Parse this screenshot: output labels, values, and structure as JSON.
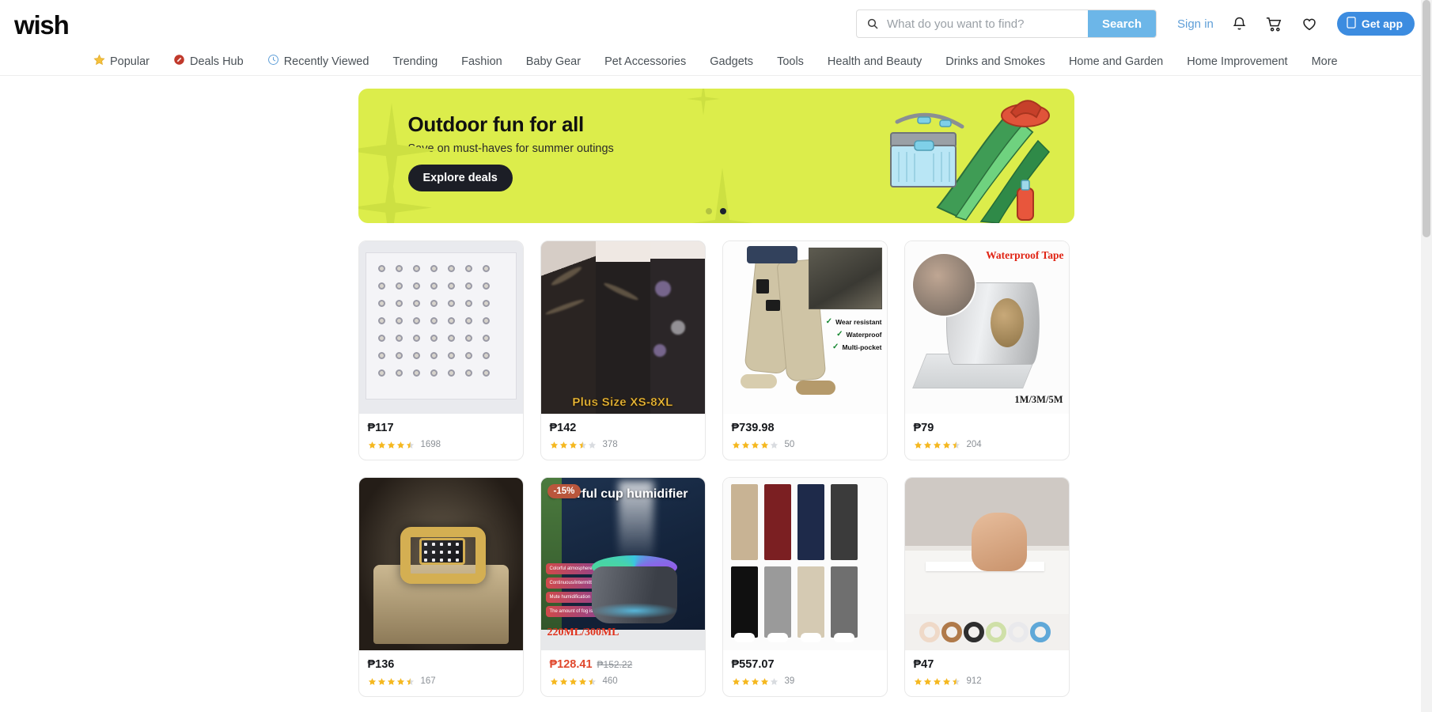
{
  "brand": {
    "logo_text": "wish"
  },
  "search": {
    "placeholder": "What do you want to find?",
    "value": "",
    "button_label": "Search",
    "icon": "search-icon"
  },
  "account": {
    "signin_label": "Sign in",
    "bell_icon": "bell-icon",
    "cart_icon": "cart-icon",
    "wishlist_icon": "heart-icon",
    "getapp_label": "Get app",
    "getapp_icon": "mobile-phone-icon"
  },
  "nav": {
    "items": [
      {
        "label": "Popular",
        "icon": "star-icon"
      },
      {
        "label": "Deals Hub",
        "icon": "tag-icon"
      },
      {
        "label": "Recently Viewed",
        "icon": "clock-icon"
      },
      {
        "label": "Trending",
        "icon": ""
      },
      {
        "label": "Fashion",
        "icon": ""
      },
      {
        "label": "Baby Gear",
        "icon": ""
      },
      {
        "label": "Pet Accessories",
        "icon": ""
      },
      {
        "label": "Gadgets",
        "icon": ""
      },
      {
        "label": "Tools",
        "icon": ""
      },
      {
        "label": "Health and Beauty",
        "icon": ""
      },
      {
        "label": "Drinks and Smokes",
        "icon": ""
      },
      {
        "label": "Home and Garden",
        "icon": ""
      },
      {
        "label": "Home Improvement",
        "icon": ""
      },
      {
        "label": "More",
        "icon": ""
      }
    ]
  },
  "banner": {
    "title": "Outdoor fun for all",
    "subtitle": "Save on must-haves for summer outings",
    "cta_label": "Explore deals",
    "background_color": "#dced4b",
    "cta_background": "#1c1e26",
    "dots": [
      {
        "active": false
      },
      {
        "active": true
      }
    ]
  },
  "products": [
    {
      "name": "stainless-steel-ring-assortment",
      "price": "₱117",
      "old_price": "",
      "rating": 4.5,
      "reviews": "1698",
      "badge": "",
      "image_caption": ""
    },
    {
      "name": "plus-size-marble-print-leggings",
      "price": "₱142",
      "old_price": "",
      "rating": 3.5,
      "reviews": "378",
      "badge": "",
      "image_caption": "Plus Size XS-8XL"
    },
    {
      "name": "tactical-cargo-pants",
      "price": "₱739.98",
      "old_price": "",
      "rating": 4.0,
      "reviews": "50",
      "badge": "",
      "image_caption": "",
      "features": [
        "Wear resistant",
        "Waterproof",
        "Multi-pocket"
      ]
    },
    {
      "name": "butyl-waterproof-tape",
      "price": "₱79",
      "old_price": "",
      "rating": 4.5,
      "reviews": "204",
      "badge": "",
      "image_caption": "Waterproof Tape",
      "image_caption2": "1M/3M/5M"
    },
    {
      "name": "gold-diamond-ring-in-box",
      "price": "₱136",
      "old_price": "",
      "rating": 4.5,
      "reviews": "167",
      "badge": "",
      "image_caption": ""
    },
    {
      "name": "colorful-cup-humidifier",
      "price": "₱128.41",
      "old_price": "₱152.22",
      "rating": 4.5,
      "reviews": "460",
      "badge": "-15%",
      "image_caption": "Colorful cup humidifier",
      "image_caption2": "220ML/300ML",
      "feature_chips": [
        "Colorful atmosphere lights",
        "Continuous/intermittent spray",
        "Mute humidification",
        "The amount of fog is visible"
      ]
    },
    {
      "name": "casual-cargo-joggers",
      "price": "₱557.07",
      "old_price": "",
      "rating": 4.0,
      "reviews": "39",
      "badge": "",
      "image_caption": ""
    },
    {
      "name": "bathtub-caulk-sealing-tape",
      "price": "₱47",
      "old_price": "",
      "rating": 4.5,
      "reviews": "912",
      "badge": "",
      "image_caption": ""
    }
  ],
  "colors": {
    "search_button": "#6cb6e8",
    "signin_link": "#5f9fd8",
    "getapp_button": "#3c8ce0",
    "star_filled": "#f5b820",
    "star_empty": "#d9dce0",
    "sale_price": "#e0472c",
    "badge_background": "#b9563c"
  }
}
